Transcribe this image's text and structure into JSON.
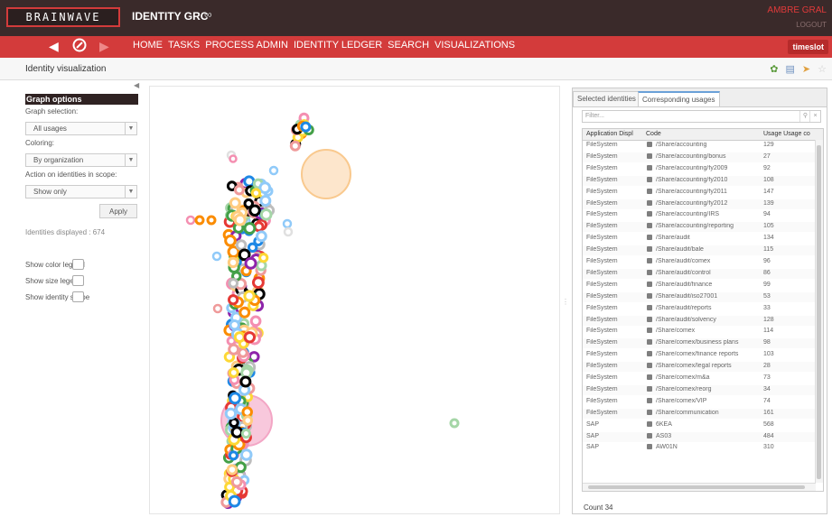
{
  "header": {
    "logo": "BRAINWAVE",
    "app_title": "IDENTITY GRC",
    "app_title_symbol": "∞",
    "user": "AMBRE GRAL",
    "logout": "LOGOUT",
    "timeslot": "timeslot"
  },
  "nav": {
    "back_icon": "back-arrow-icon",
    "compass_icon": "compass-icon",
    "forward_icon": "forward-arrow-icon",
    "items": [
      "HOME",
      "TASKS",
      "PROCESS ADMIN",
      "IDENTITY LEDGER",
      "SEARCH",
      "VISUALIZATIONS"
    ]
  },
  "page": {
    "title": "Identity visualization"
  },
  "graph_options": {
    "header": "Graph options",
    "graph_selection_label": "Graph selection:",
    "graph_selection_value": "All usages",
    "coloring_label": "Coloring:",
    "coloring_value": "By organization",
    "action_label": "Action on identities in scope:",
    "action_value": "Show only",
    "apply": "Apply",
    "identities_displayed": "Identities displayed : 674",
    "show_color_legend": "Show color legend",
    "show_size_legend": "Show size legend",
    "show_identity_scope": "Show identity scope"
  },
  "right_panel": {
    "tabs": [
      "Selected identities",
      "Corresponding usages"
    ],
    "filter_placeholder": "Filter...",
    "columns": [
      "Application Displ",
      "Code",
      "Usage Usage co"
    ],
    "rows": [
      [
        "FileSystem",
        "/Share/accounting",
        "129"
      ],
      [
        "FileSystem",
        "/Share/accounting/bonus",
        "27"
      ],
      [
        "FileSystem",
        "/Share/accounting/fy2009",
        "92"
      ],
      [
        "FileSystem",
        "/Share/accounting/fy2010",
        "108"
      ],
      [
        "FileSystem",
        "/Share/accounting/fy2011",
        "147"
      ],
      [
        "FileSystem",
        "/Share/accounting/fy2012",
        "139"
      ],
      [
        "FileSystem",
        "/Share/accounting/IRS",
        "94"
      ],
      [
        "FileSystem",
        "/Share/accounting/reporting",
        "105"
      ],
      [
        "FileSystem",
        "/Share/audit",
        "134"
      ],
      [
        "FileSystem",
        "/Share/audit/bale",
        "115"
      ],
      [
        "FileSystem",
        "/Share/audit/comex",
        "96"
      ],
      [
        "FileSystem",
        "/Share/audit/control",
        "86"
      ],
      [
        "FileSystem",
        "/Share/audit/finance",
        "99"
      ],
      [
        "FileSystem",
        "/Share/audit/iso27001",
        "53"
      ],
      [
        "FileSystem",
        "/Share/audit/reports",
        "33"
      ],
      [
        "FileSystem",
        "/Share/audit/solvency",
        "128"
      ],
      [
        "FileSystem",
        "/Share/comex",
        "114"
      ],
      [
        "FileSystem",
        "/Share/comex/business plans",
        "98"
      ],
      [
        "FileSystem",
        "/Share/comex/finance reports",
        "103"
      ],
      [
        "FileSystem",
        "/Share/comex/legal reports",
        "28"
      ],
      [
        "FileSystem",
        "/Share/comex/m&a",
        "73"
      ],
      [
        "FileSystem",
        "/Share/comex/reorg",
        "34"
      ],
      [
        "FileSystem",
        "/Share/comex/VIP",
        "74"
      ],
      [
        "FileSystem",
        "/Share/communication",
        "161"
      ],
      [
        "SAP",
        "6KEA",
        "568"
      ],
      [
        "SAP",
        "AS03",
        "484"
      ],
      [
        "SAP",
        "AW01N",
        "310"
      ]
    ],
    "count": "Count 34"
  },
  "colors": {
    "topbar": "#3a2a2a",
    "navbar": "#d33b3b",
    "accent": "#d33b3b"
  }
}
